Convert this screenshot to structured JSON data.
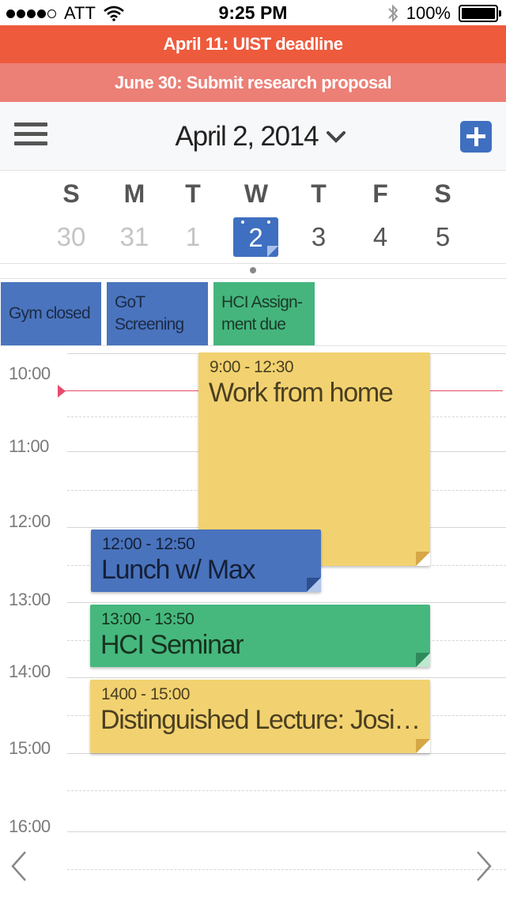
{
  "status_bar": {
    "carrier": "ATT",
    "time": "9:25 PM",
    "battery": "100%"
  },
  "banners": [
    {
      "text": "April 11: UIST deadline",
      "color": "#ee5a3c"
    },
    {
      "text": "June 30: Submit research proposal",
      "color": "#ec7f76"
    }
  ],
  "header": {
    "date": "April 2, 2014"
  },
  "week": {
    "days": [
      {
        "dow": "S",
        "num": "30"
      },
      {
        "dow": "M",
        "num": "31"
      },
      {
        "dow": "T",
        "num": "1"
      },
      {
        "dow": "W",
        "num": "2"
      },
      {
        "dow": "T",
        "num": "3"
      },
      {
        "dow": "F",
        "num": "4"
      },
      {
        "dow": "S",
        "num": "5"
      }
    ],
    "selected_index": 3
  },
  "all_day": [
    {
      "text": "Gym closed",
      "color": "#4a74bd"
    },
    {
      "text": "GoT Screening",
      "color": "#4a74bd"
    },
    {
      "text": "HCI Assign-ment due",
      "color": "#45b57d"
    }
  ],
  "hours": [
    "10:00",
    "11:00",
    "12:00",
    "13:00",
    "14:00",
    "15:00",
    "16:00"
  ],
  "events": [
    {
      "time": "9:00 - 12:30",
      "title": "Work from home",
      "color": "#f2d270"
    },
    {
      "time": "12:00 - 12:50",
      "title": "Lunch w/ Max",
      "color": "#4a73bd"
    },
    {
      "time": "13:00 - 13:50",
      "title": "HCI Seminar",
      "color": "#46b87d"
    },
    {
      "time": "1400 - 15:00",
      "title": "Distinguished Lecture: Josiah Carberry",
      "color": "#f2d270"
    }
  ],
  "icons": {
    "menu": "hamburger-icon",
    "add": "plus-icon",
    "prev": "chevron-left-icon",
    "next": "chevron-right-icon",
    "wifi": "wifi-icon",
    "bluetooth": "bluetooth-icon"
  }
}
